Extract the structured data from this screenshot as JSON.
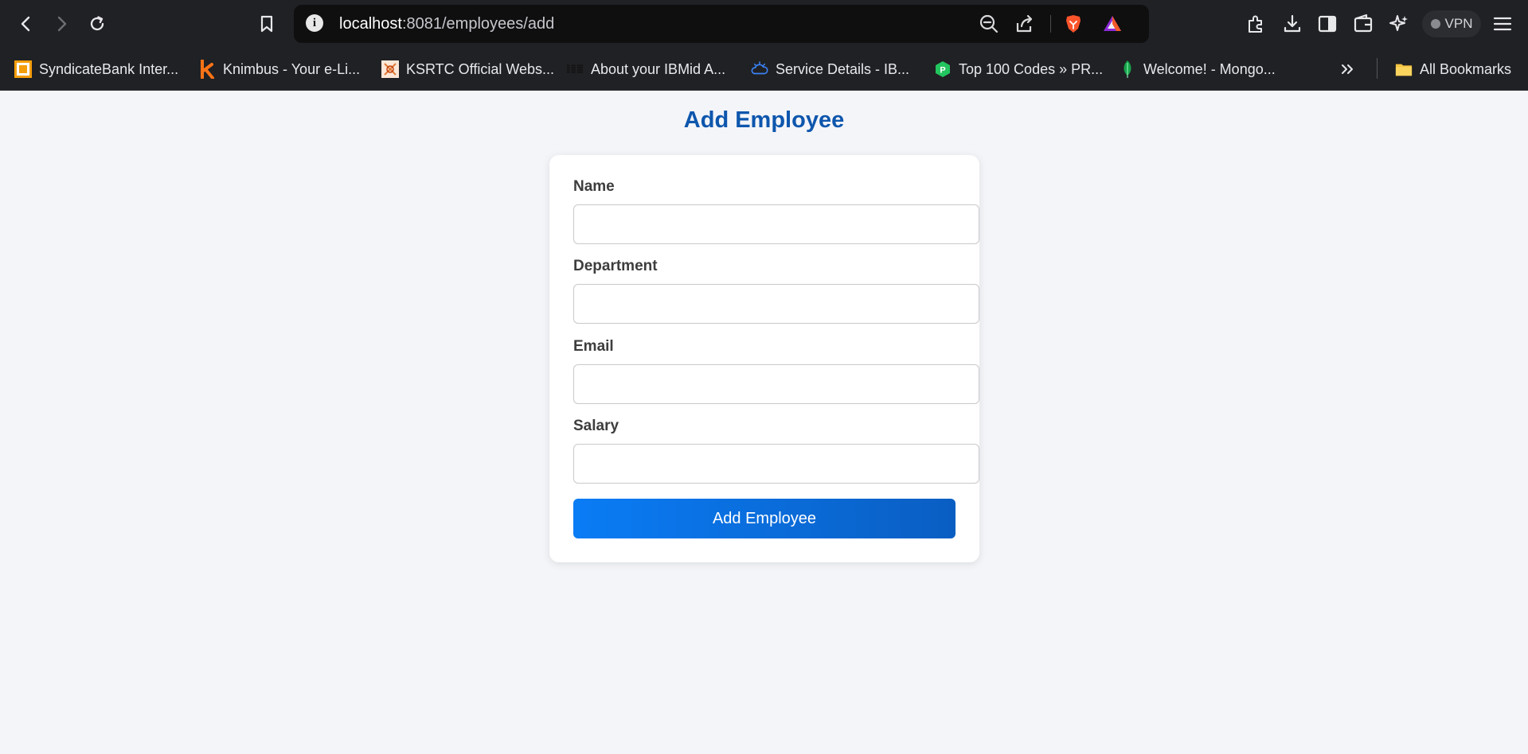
{
  "browser": {
    "url_host": "localhost",
    "url_path": ":8081/employees/add",
    "vpn_label": "VPN",
    "bookmarks": [
      {
        "label": "SyndicateBank Inter...",
        "icon": "syndicatebank-icon"
      },
      {
        "label": "Knimbus - Your e-Li...",
        "icon": "knimbus-icon"
      },
      {
        "label": "KSRTC Official Webs...",
        "icon": "ksrtc-icon"
      },
      {
        "label": "About your IBMid A...",
        "icon": "ibm-icon"
      },
      {
        "label": "Service Details - IB...",
        "icon": "ibm-cloud-icon"
      },
      {
        "label": "Top 100 Codes » PR...",
        "icon": "prepinsta-icon"
      },
      {
        "label": "Welcome! - Mongo...",
        "icon": "mongodb-leaf-icon"
      }
    ],
    "all_bookmarks_label": "All Bookmarks"
  },
  "page": {
    "title": "Add Employee",
    "fields": {
      "name": {
        "label": "Name",
        "value": ""
      },
      "department": {
        "label": "Department",
        "value": ""
      },
      "email": {
        "label": "Email",
        "value": ""
      },
      "salary": {
        "label": "Salary",
        "value": ""
      }
    },
    "submit_label": "Add Employee"
  },
  "colors": {
    "title": "#0d56ad",
    "button_start": "#0a7cf5",
    "button_end": "#0a5ec2",
    "background": "#f4f5f9"
  }
}
